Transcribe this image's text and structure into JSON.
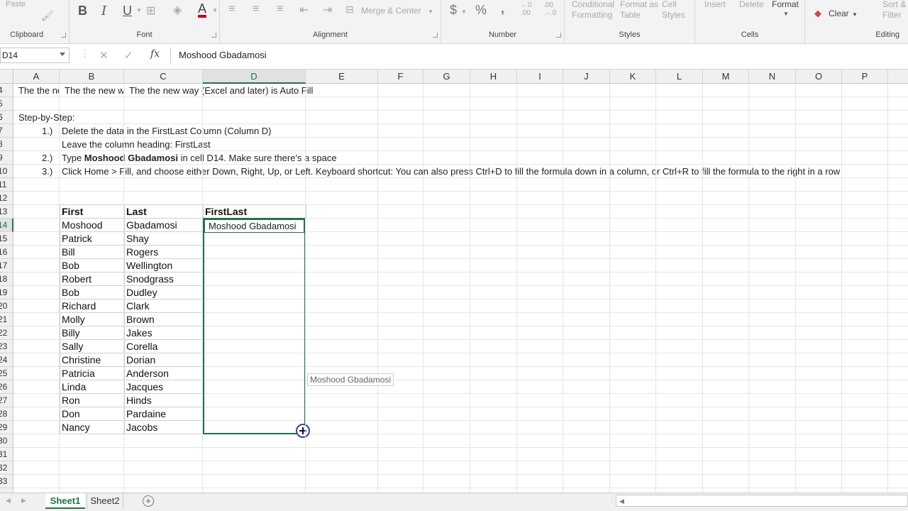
{
  "ribbon": {
    "clipboard": {
      "paste_label": "Paste",
      "group_label": "Clipboard"
    },
    "font": {
      "bold": "B",
      "italic": "I",
      "underline": "U",
      "font_color_glyph": "A",
      "group_label": "Font"
    },
    "alignment": {
      "merge_label": "Merge & Center",
      "group_label": "Alignment"
    },
    "number": {
      "currency": "$",
      "percent": "%",
      "comma": ",",
      "inc_dec_top": "←0",
      "inc_dec_bottom": ".00",
      "dec_dec_top": ".00",
      "dec_dec_bottom": "→.0",
      "group_label": "Number"
    },
    "styles": {
      "cond_label_1": "Conditional",
      "cond_label_2": "Formatting",
      "fmt_table_1": "Format as",
      "fmt_table_2": "Table",
      "cell_styles_1": "Cell",
      "cell_styles_2": "Styles",
      "group_label": "Styles"
    },
    "cells": {
      "insert": "Insert",
      "delete": "Delete",
      "format": "Format",
      "group_label": "Cells"
    },
    "editing": {
      "clear": "Clear",
      "sort_1": "Sort &",
      "sort_2": "Filter",
      "group_label": "Editing"
    }
  },
  "formula_bar": {
    "name_box": "D14",
    "cancel": "✕",
    "enter": "✓",
    "fx": "fx",
    "value": "Moshood Gbadamosi"
  },
  "columns": [
    "A",
    "B",
    "C",
    "D",
    "E",
    "F",
    "G",
    "H",
    "I",
    "J",
    "K",
    "L",
    "M",
    "N",
    "O",
    "P"
  ],
  "selected_column": "D",
  "rows": [
    "4",
    "5",
    "6",
    "7",
    "8",
    "9",
    "10",
    "11",
    "12",
    "13",
    "14",
    "15",
    "16",
    "17",
    "18",
    "19",
    "20",
    "21",
    "22",
    "23",
    "24",
    "25",
    "26",
    "27",
    "28",
    "29",
    "30",
    "31",
    "32",
    "33"
  ],
  "selected_row": "14",
  "text_rows": {
    "r4_a": "The the ne",
    "r4_b": "The the new w",
    "r4_c": "The the new way (Excel and later) is Auto Fill",
    "r6": "Step-by-Step:",
    "r7_num": "1.)",
    "r7_text": "Delete the data in the FirstLast Column (Column D)",
    "r8_text": "Leave the column heading:  FirstLast",
    "r9_num": "2.)",
    "r9_pre": "Type ",
    "r9_bold": "Moshood Gbadamosi",
    "r9_post": " in cell D14. Make sure there's a space",
    "r10_num": "3.)",
    "r10_text": "Click Home > Fill, and choose either Down, Right, Up, or Left. Keyboard shortcut: You can also press Ctrl+D to fill the formula down in a column, or Ctrl+R to fill the formula to the right in a row"
  },
  "table": {
    "headers": [
      "First",
      "Last",
      "FirstLast"
    ],
    "first": [
      "Moshood",
      "Patrick",
      "Bill",
      "Bob",
      "Robert",
      "Bob",
      "Richard",
      "Molly",
      "Billy",
      "Sally",
      "Christine",
      "Patricia",
      "Linda",
      "Ron",
      "Don",
      "Nancy"
    ],
    "last": [
      "Gbadamosi",
      "Shay",
      "Rogers",
      "Wellington",
      "Snodgrass",
      "Dudley",
      "Clark",
      "Brown",
      "Jakes",
      "Corella",
      "Dorian",
      "Anderson",
      "Jacques",
      "Hinds",
      "Pardaine",
      "Jacobs"
    ],
    "d14_value": "Moshood Gbadamosi"
  },
  "fill_tooltip": "Moshood Gbadamosi",
  "sheets": {
    "tabs": [
      "Sheet1",
      "Sheet2"
    ],
    "active": "Sheet1",
    "add": "+"
  },
  "colors": {
    "accent": "#217346",
    "cursor_ring": "#3d3da8"
  }
}
